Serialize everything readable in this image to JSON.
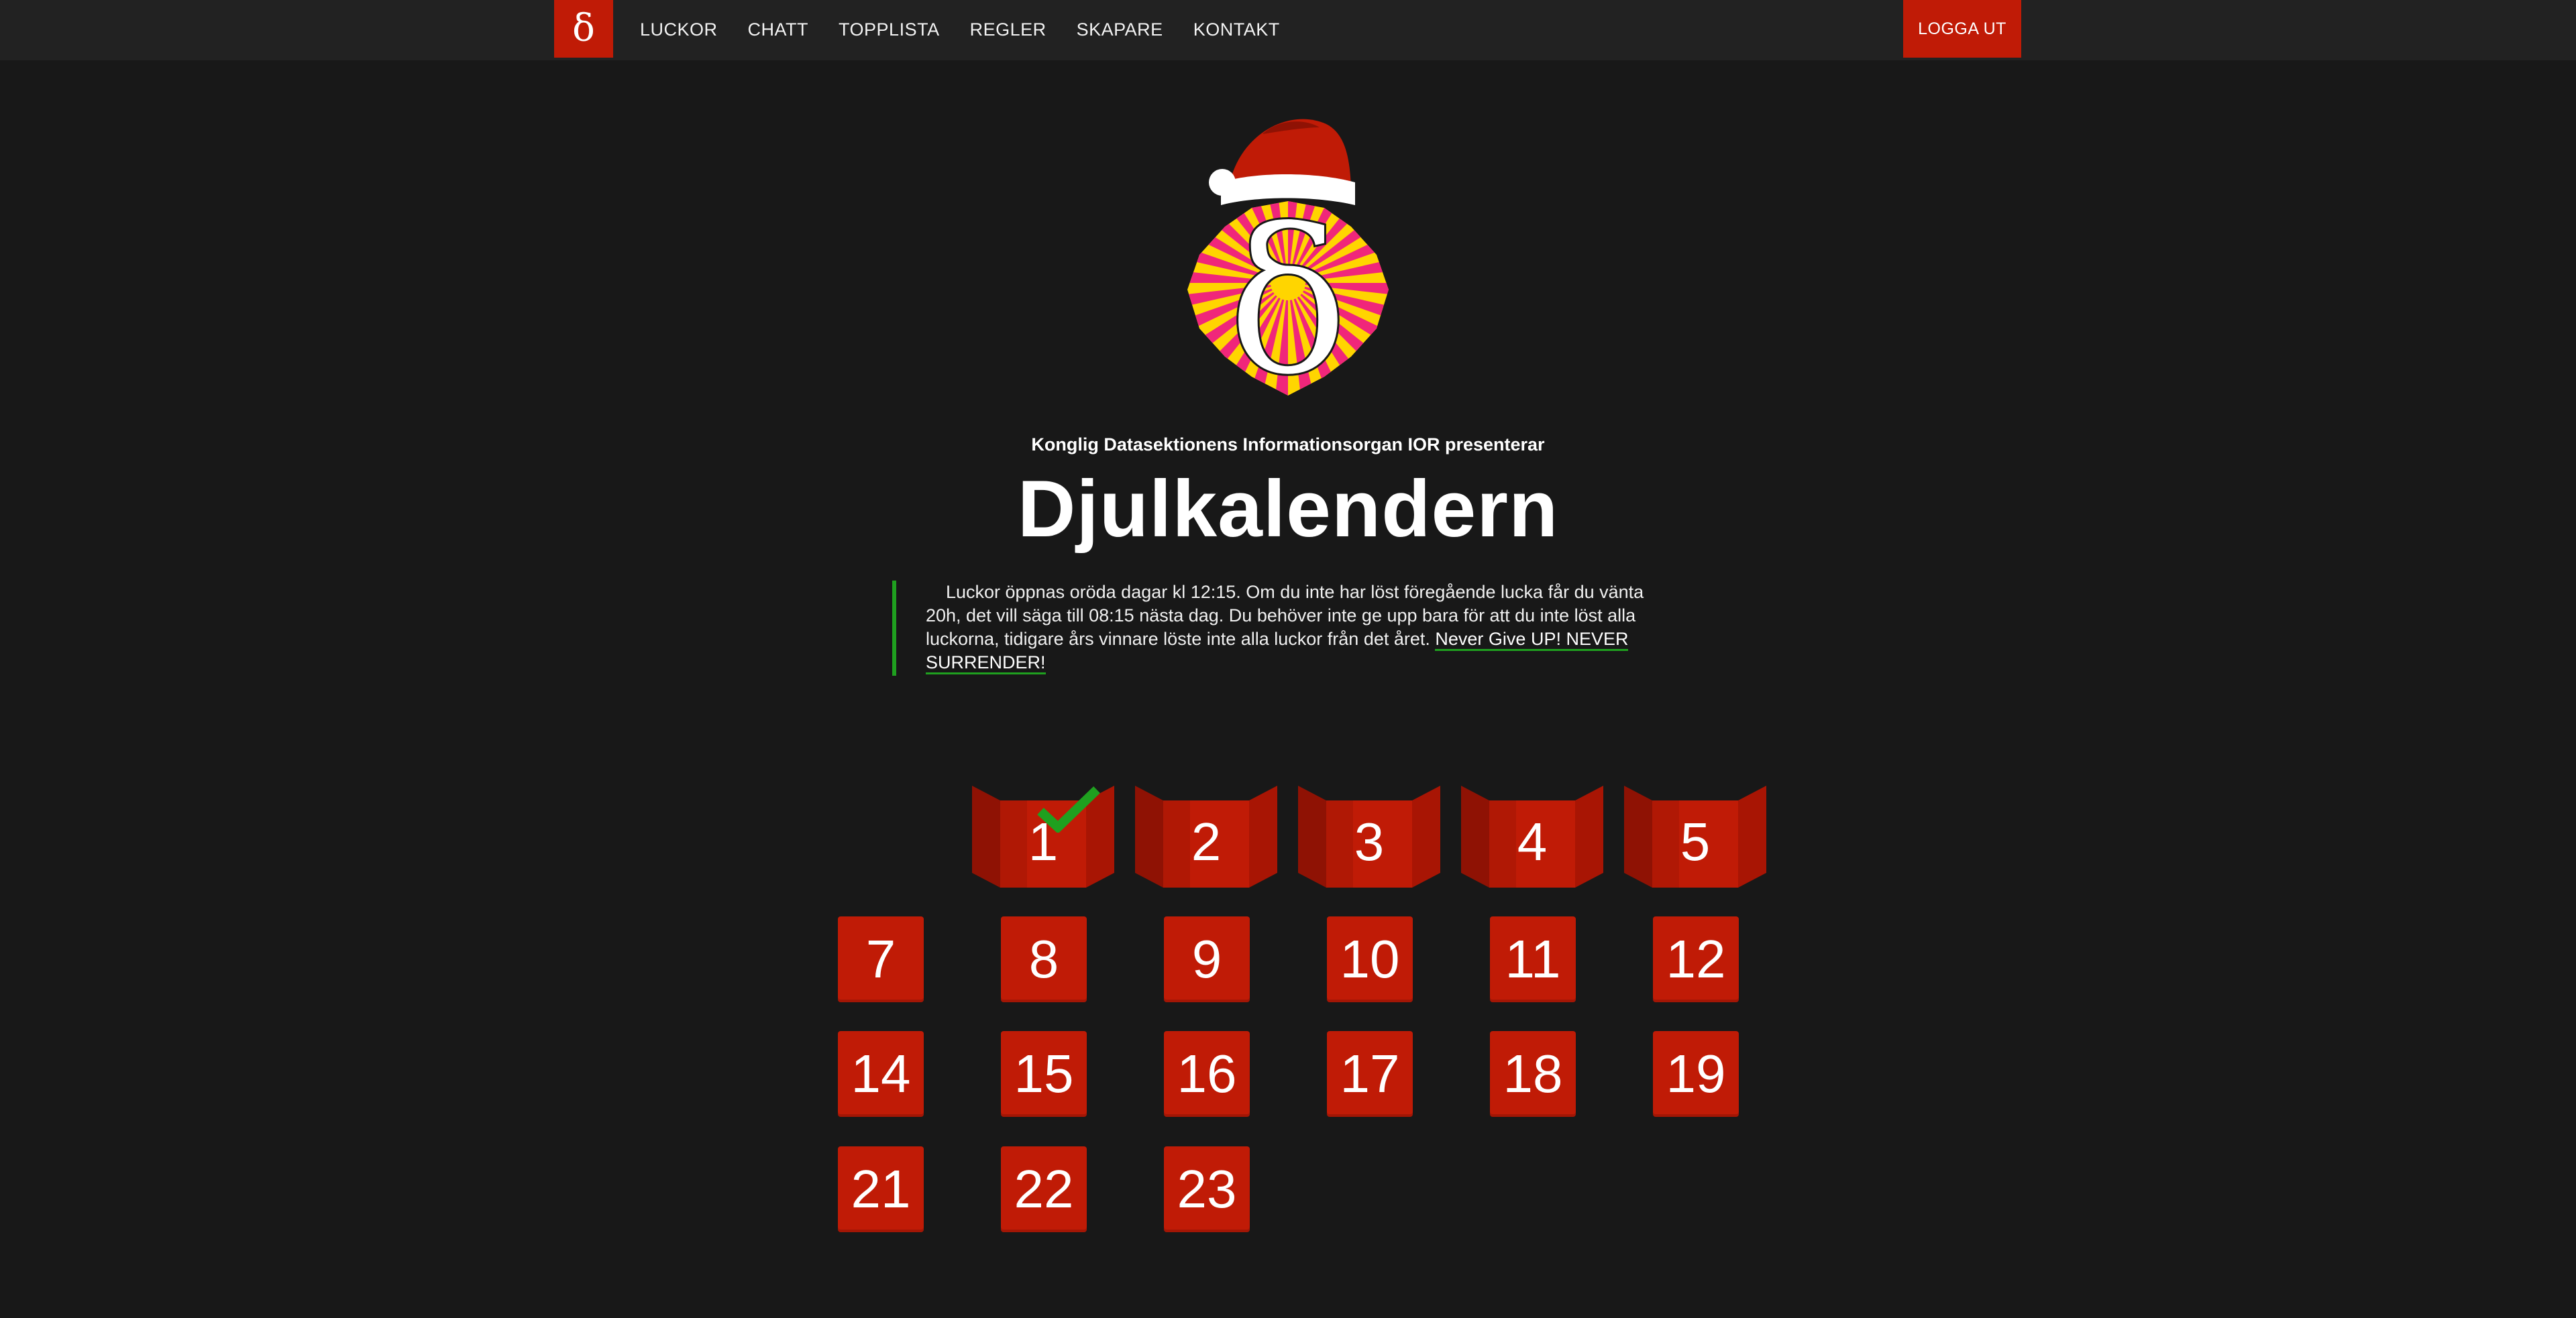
{
  "nav": {
    "logo_glyph": "δ",
    "links": [
      "LUCKOR",
      "CHATT",
      "TOPPLISTA",
      "REGLER",
      "SKAPARE",
      "KONTAKT"
    ],
    "logout_label": "LOGGA UT",
    "accent": "#c01b06"
  },
  "header": {
    "mascot_glyph": "δ",
    "presents": "Konglig Datasektionens Informationsorgan IOR presenterar",
    "title": "Djulkalendern",
    "rules_text": "Luckor öppnas oröda dagar kl 12:15. Om du inte har löst föregående lucka får du vänta 20h, det vill säga till 08:15 nästa dag. Du behöver inte ge upp bara för att du inte löst alla luckorna, tidigare års vinnare löste inte alla luckor från det året.",
    "rules_link": "Never Give UP! NEVER SURRENDER!",
    "rule_bar_color": "#1fa01f"
  },
  "calendar": {
    "open_doors": [
      {
        "label": "1",
        "solved": true
      },
      {
        "label": "2",
        "solved": false
      },
      {
        "label": "3",
        "solved": false
      },
      {
        "label": "4",
        "solved": false
      },
      {
        "label": "5",
        "solved": false
      }
    ],
    "days": [
      "7",
      "8",
      "9",
      "10",
      "11",
      "12",
      "14",
      "15",
      "16",
      "17",
      "18",
      "19",
      "21",
      "22",
      "23"
    ],
    "check_icon": "checkmark-icon",
    "check_color": "#1fa01f"
  }
}
